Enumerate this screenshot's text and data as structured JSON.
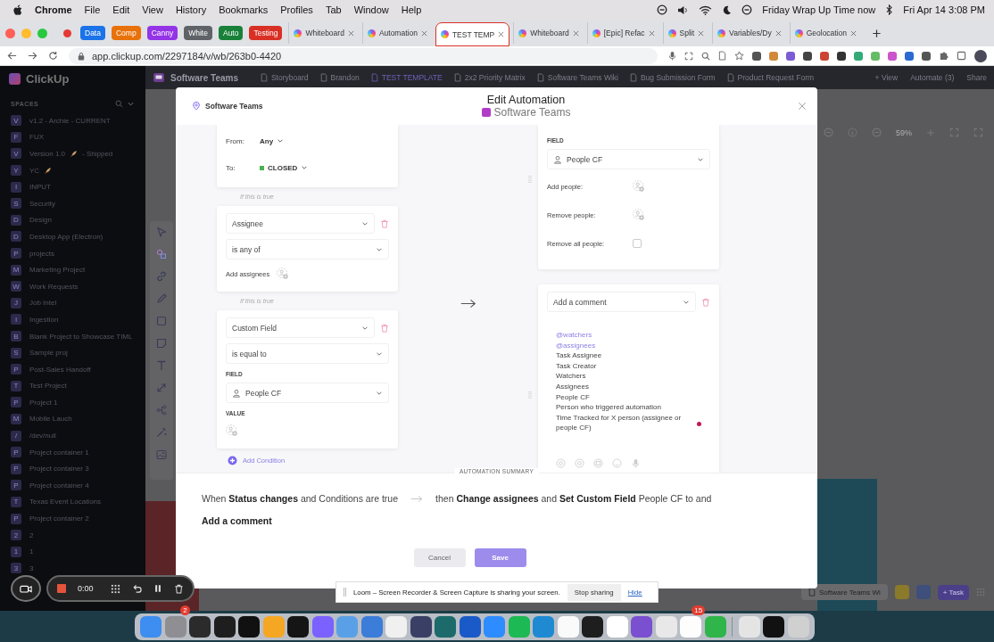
{
  "menubar": {
    "app": "Chrome",
    "menus": [
      "File",
      "Edit",
      "View",
      "History",
      "Bookmarks",
      "Profiles",
      "Tab",
      "Window",
      "Help"
    ],
    "status_text": "Friday Wrap Up Time now",
    "clock": "Fri Apr 14  3:08 PM"
  },
  "browser": {
    "tab_groups": [
      {
        "label": "Data",
        "color": "#1a73e8"
      },
      {
        "label": "Comp",
        "color": "#e8710a"
      },
      {
        "label": "Canny",
        "color": "#9334e6"
      },
      {
        "label": "White",
        "color": "#5f6368"
      },
      {
        "label": "Auto",
        "color": "#188038"
      },
      {
        "label": "Testing",
        "color": "#d93025"
      }
    ],
    "tabs": [
      {
        "title": "Whiteboard",
        "selected": false
      },
      {
        "title": "Automation",
        "selected": false
      },
      {
        "title": "TEST TEMP",
        "selected": true
      },
      {
        "title": "Whiteboard",
        "selected": false
      },
      {
        "title": "[Epic] Refac",
        "selected": false
      },
      {
        "title": "Split",
        "selected": false
      },
      {
        "title": "Variables/Dy",
        "selected": false
      },
      {
        "title": "Geolocation",
        "selected": false
      }
    ],
    "url": "app.clickup.com/2297184/v/wb/263b0-4420"
  },
  "sidebar": {
    "logo": "ClickUp",
    "section": "SPACES",
    "spaces": [
      {
        "initial": "V",
        "name": "v1.2 - Archie - CURRENT"
      },
      {
        "initial": "F",
        "name": "FUX"
      },
      {
        "initial": "V",
        "name": "Version 1.0",
        "rocket": true,
        "suffix": "- Shipped"
      },
      {
        "initial": "Y",
        "name": "YC",
        "rocket": true
      },
      {
        "initial": "I",
        "name": "INPUT"
      },
      {
        "initial": "S",
        "name": "Security"
      },
      {
        "initial": "D",
        "name": "Design"
      },
      {
        "initial": "D",
        "name": "Desktop App (Electron)"
      },
      {
        "initial": "P",
        "name": "projects"
      },
      {
        "initial": "M",
        "name": "Marketing Project"
      },
      {
        "initial": "W",
        "name": "Work Requests"
      },
      {
        "initial": "J",
        "name": "Job Intel"
      },
      {
        "initial": "I",
        "name": "Ingestion"
      },
      {
        "initial": "B",
        "name": "Blank Project to Showcase TIML"
      },
      {
        "initial": "S",
        "name": "Sample proj"
      },
      {
        "initial": "P",
        "name": "Post-Sales Handoff"
      },
      {
        "initial": "T",
        "name": "Test Project"
      },
      {
        "initial": "P",
        "name": "Project 1"
      },
      {
        "initial": "M",
        "name": "Mobile Lauch"
      },
      {
        "initial": "/",
        "name": "/dev/null"
      },
      {
        "initial": "P",
        "name": "Project container 1"
      },
      {
        "initial": "P",
        "name": "Project container 3"
      },
      {
        "initial": "P",
        "name": "Project container 4"
      },
      {
        "initial": "T",
        "name": "Texas Event Locations"
      },
      {
        "initial": "P",
        "name": "Project container 2"
      },
      {
        "initial": "2",
        "name": "2"
      },
      {
        "initial": "1",
        "name": "1"
      },
      {
        "initial": "3",
        "name": "3"
      }
    ]
  },
  "view_bar": {
    "space": "Software Teams",
    "views": [
      {
        "label": "Storyboard",
        "selected": false
      },
      {
        "label": "Brandon",
        "selected": false
      },
      {
        "label": "TEST TEMPLATE",
        "selected": true
      },
      {
        "label": "2x2 Priority Matrix",
        "selected": false
      },
      {
        "label": "Software Teams Wiki",
        "selected": false
      },
      {
        "label": "Bug Submission Form",
        "selected": false
      },
      {
        "label": "Product Request Form",
        "selected": false
      }
    ],
    "add_view": "+ View",
    "automate": "Automate (3)",
    "share": "Share"
  },
  "canvas": {
    "zoom": "59%",
    "doc_chip": "Software Teams Wi",
    "task_button": "+ Task"
  },
  "modal": {
    "location": "Software Teams",
    "title": "Edit Automation",
    "subtitle": "Software Teams",
    "trigger": {
      "from_label": "From:",
      "from_value": "Any",
      "to_label": "To:",
      "to_status": {
        "label": "CLOSED",
        "color": "#4caf50"
      }
    },
    "conditions": [
      {
        "connector": "If this is true",
        "field": "Assignee",
        "operator": "is any of",
        "kind": "assignees",
        "add_label": "Add assignees"
      },
      {
        "connector": "If this is true",
        "field": "Custom Field",
        "operator": "is equal to",
        "kind": "custom",
        "field_label": "FIELD",
        "field_value": "People CF",
        "value_label": "VALUE"
      }
    ],
    "add_condition": "Add Condition",
    "action_people": {
      "field_label": "FIELD",
      "field_value": "People CF",
      "add_label": "Add people:",
      "remove_label": "Remove people:",
      "remove_all_label": "Remove all people:",
      "remove_all_checked": false
    },
    "action_comment": {
      "action": "Add a comment",
      "lines": [
        {
          "text": "@watchers",
          "kind": "mention"
        },
        {
          "text": "@assignees",
          "kind": "mention"
        },
        {
          "text": "Task Assignee",
          "kind": "plain"
        },
        {
          "text": "Task Creator",
          "kind": "plain"
        },
        {
          "text": "Watchers",
          "kind": "plain"
        },
        {
          "text": "Assignees",
          "kind": "plain"
        },
        {
          "text": "People CF",
          "kind": "plain"
        },
        {
          "text": "Person who triggered automation",
          "kind": "plain"
        },
        {
          "text": "Time Tracked for X person (assignee or people CF)",
          "kind": "plain"
        }
      ]
    },
    "summary_label": "AUTOMATION SUMMARY",
    "summary_when": "When **Status changes** and Conditions are true",
    "summary_then": "then **Change assignees** and **Set Custom Field** People CF to  and",
    "summary_more": "Add a comment",
    "cancel": "Cancel",
    "save": "Save",
    "save_disabled": true
  },
  "loom": {
    "timer": "0:00",
    "message": "Loom – Screen Recorder & Screen Capture is sharing your screen.",
    "stop": "Stop sharing",
    "hide": "Hide"
  },
  "dock": {
    "apps": [
      {
        "color": "#3d8ef0"
      },
      {
        "color": "#8e8e93",
        "badge": "2"
      },
      {
        "color": "#2b2b2b"
      },
      {
        "color": "#1e1e1e"
      },
      {
        "color": "#111111"
      },
      {
        "color": "#f5a623"
      },
      {
        "color": "#151515"
      },
      {
        "color": "#7b61ff"
      },
      {
        "color": "#5aa0e6"
      },
      {
        "color": "#3b7dd8"
      },
      {
        "color": "#f0f0f0"
      },
      {
        "color": "#3a3f66"
      },
      {
        "color": "#1d6a6a"
      },
      {
        "color": "#1a5ac8"
      },
      {
        "color": "#2d8cff"
      },
      {
        "color": "#1db954"
      },
      {
        "color": "#1f8ad2"
      },
      {
        "color": "#fafafa"
      },
      {
        "color": "#1e1e1e"
      },
      {
        "color": "#ffffff"
      },
      {
        "color": "#7a4fd0"
      },
      {
        "color": "#e8e8e8"
      },
      {
        "color": "#fdfdfd",
        "badge": "15"
      },
      {
        "color": "#2fb54a"
      },
      {
        "color": "#e4e4e4"
      },
      {
        "color": "#111112"
      },
      {
        "color": "#d0d0d0"
      }
    ]
  }
}
